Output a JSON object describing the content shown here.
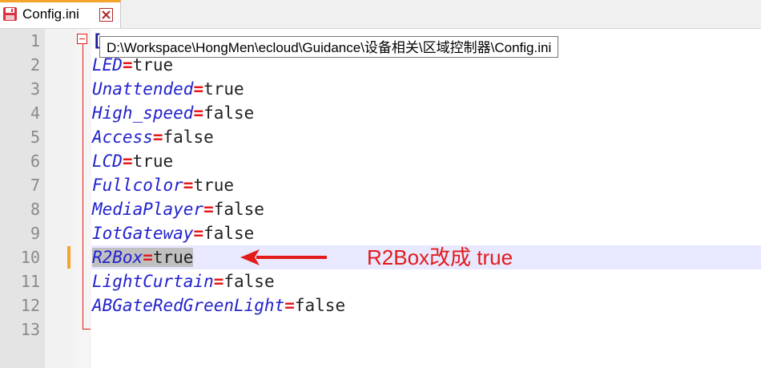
{
  "tab": {
    "title": "Config.ini"
  },
  "tooltip": {
    "path": "D:\\Workspace\\HongMen\\ecloud\\Guidance\\设备相关\\区域控制器\\Config.ini"
  },
  "section_partial": "[",
  "line_numbers": [
    "1",
    "2",
    "3",
    "4",
    "5",
    "6",
    "7",
    "8",
    "9",
    "10",
    "11",
    "12",
    "13"
  ],
  "lines": [
    {
      "key": "LED",
      "eq": "=",
      "value": "true"
    },
    {
      "key": "Unattended",
      "eq": "=",
      "value": "true"
    },
    {
      "key": "High_speed",
      "eq": "=",
      "value": "false"
    },
    {
      "key": "Access",
      "eq": "=",
      "value": "false"
    },
    {
      "key": "LCD",
      "eq": "=",
      "value": "true"
    },
    {
      "key": "Fullcolor",
      "eq": "=",
      "value": "true"
    },
    {
      "key": "MediaPlayer",
      "eq": "=",
      "value": "false"
    },
    {
      "key": "IotGateway",
      "eq": "=",
      "value": "false"
    },
    {
      "key": "R2Box",
      "eq": "=",
      "value": "true"
    },
    {
      "key": "LightCurtain",
      "eq": "=",
      "value": "false"
    },
    {
      "key": "ABGateRedGreenLight",
      "eq": "=",
      "value": "false"
    }
  ],
  "annotation": {
    "text": "R2Box改成 true"
  },
  "colors": {
    "key": "#2222cc",
    "equals": "#e31a1a",
    "annotation": "#e31a1a",
    "current_line": "#e8e8ff",
    "tab_accent": "#f4a32b"
  },
  "icons": [
    "save-icon",
    "close-icon",
    "fold-minus-icon",
    "arrow-icon"
  ]
}
